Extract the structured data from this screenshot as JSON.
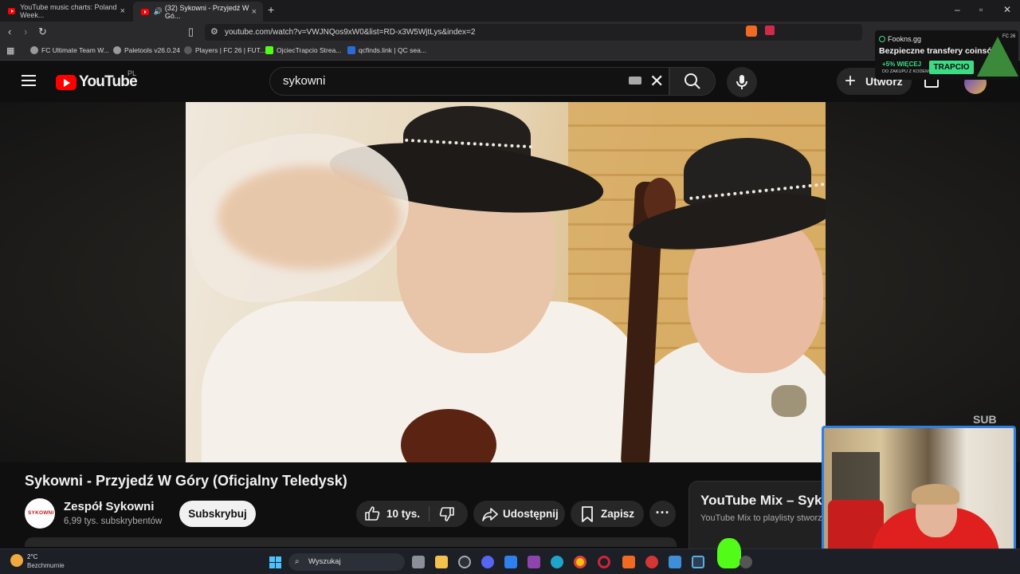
{
  "browser": {
    "tabs": [
      {
        "label": "YouTube music charts: Poland Week..."
      },
      {
        "label": "(32) Sykowni - Przyjedź W Gó..."
      }
    ],
    "url": "youtube.com/watch?v=VWJNQos9xW0&list=RD-x3W5WjtLys&index=2",
    "bookmarks": [
      {
        "label": "FC Ultimate Team W..."
      },
      {
        "label": "Paletools v26.0.24"
      },
      {
        "label": "Players | FC 26 | FUT..."
      },
      {
        "label": "OjciecTrapcio Strea..."
      },
      {
        "label": "qcfinds.link | QC sea..."
      }
    ]
  },
  "youtube": {
    "logo_text": "YouTube",
    "country_code": "PL",
    "search_value": "sykowni",
    "create_label": "Utwórz"
  },
  "player": {
    "watermark": "SUB"
  },
  "video": {
    "title": "Sykowni - Przyjedź W Góry (Oficjalny Teledysk)",
    "channel_name": "Zespół Sykowni",
    "channel_avatar_text": "SYKOWNI",
    "subscribers": "6,99 tys. subskrybentów",
    "subscribe_label": "Subskrybuj",
    "likes": "10 tys.",
    "share_label": "Udostępnij",
    "save_label": "Zapisz"
  },
  "mix": {
    "title": "YouTube Mix – Sykowni",
    "subtitle": "YouTube Mix to playlisty stworzone"
  },
  "overlay_ad": {
    "brand": "Fookns.gg",
    "title": "Bezpieczne transfery coinsów",
    "percent": "+5% WIĘCEJ",
    "note": "DO ZAKUPU Z KODEM",
    "code": "TRAPCIO",
    "corner": "FC 26"
  },
  "taskbar": {
    "temperature": "2°C",
    "condition": "Bezchmurnie",
    "search_label": "Wyszukaj"
  },
  "colors": {
    "youtube_red": "#ff0000",
    "accent_green": "#3ddc84",
    "webcam_border": "#2f7fe0"
  }
}
